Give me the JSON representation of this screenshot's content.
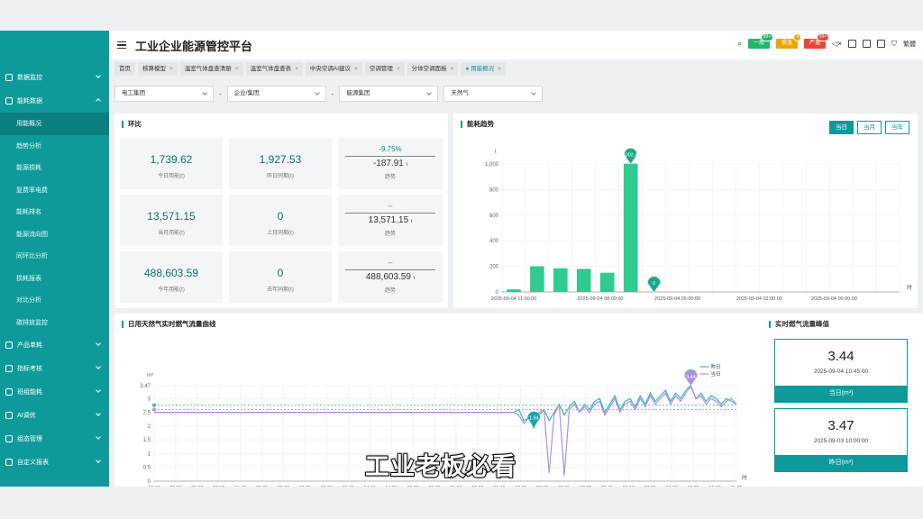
{
  "app": {
    "title": "工业企业能源管控平台",
    "subtitle_overlay": "工业老板必看"
  },
  "sidebar": {
    "items": [
      {
        "label": "数据监控",
        "expanded": false
      },
      {
        "label": "能耗数据",
        "expanded": true
      }
    ],
    "sub_items": [
      "用能概况",
      "趋势分析",
      "能源损耗",
      "复费率电费",
      "能耗排名",
      "能源流向图",
      "同环比分析",
      "损耗报表",
      "对比分析",
      "碳排放监控"
    ],
    "more_items": [
      "产品单耗",
      "指标考核",
      "班组能耗",
      "AI调优",
      "组态管理",
      "自定义报表"
    ]
  },
  "header": {
    "alarms": [
      {
        "label": "一般",
        "count": "99+",
        "color": "#1fb96a"
      },
      {
        "label": "紧急",
        "count": "4",
        "color": "#f0a500"
      },
      {
        "label": "严重",
        "count": "99+",
        "color": "#e8463c"
      }
    ],
    "lang": "繁體",
    "icons": [
      "search-icon",
      "mute-icon",
      "image-icon",
      "doc-icon",
      "copy-icon",
      "shirt-icon"
    ]
  },
  "tabs": [
    {
      "label": "首页",
      "closable": false
    },
    {
      "label": "核算模型",
      "closable": true
    },
    {
      "label": "温室气体盘查清册",
      "closable": true
    },
    {
      "label": "温室气体盘查表",
      "closable": true
    },
    {
      "label": "中央空调AI建议",
      "closable": true
    },
    {
      "label": "空调管理",
      "closable": true
    },
    {
      "label": "分体空调面板",
      "closable": true
    },
    {
      "label": "● 用能概况",
      "closable": true,
      "active": true
    }
  ],
  "filters": [
    "电工集团",
    "企业/集团",
    "能源集团",
    "天然气"
  ],
  "ring": {
    "title": "环比",
    "cards": [
      {
        "value": "1,739.62",
        "label": "今日用能(t)"
      },
      {
        "value": "1,927.53",
        "label": "昨日同期(t)"
      },
      {
        "pct": "-9.75%",
        "diff": "-187.91",
        "unit": "t",
        "label": "趋势"
      },
      {
        "value": "13,571.15",
        "label": "当月用能(t)"
      },
      {
        "value": "0",
        "label": "上月同期(t)"
      },
      {
        "pct": "--",
        "diff": "13,571.15",
        "unit": "t",
        "label": "趋势"
      },
      {
        "value": "488,603.59",
        "label": "今年用能(t)"
      },
      {
        "value": "0",
        "label": "去年同期(t)"
      },
      {
        "pct": "--",
        "diff": "488,603.59",
        "unit": "t",
        "label": "趋势"
      }
    ]
  },
  "trend": {
    "title": "能耗趋势",
    "buttons": [
      "当日",
      "当月",
      "当年"
    ],
    "active_button": "当日"
  },
  "flow": {
    "title": "日用天然气实时燃气流量曲线"
  },
  "peak": {
    "title": "实时燃气流量峰值",
    "cards": [
      {
        "value": "3.44",
        "time": "2025-09-04 10:45:00",
        "label": "当日(m³)"
      },
      {
        "value": "3.47",
        "time": "2025-09-03 10:00:00",
        "label": "昨日(m³)"
      }
    ]
  },
  "chart_data": [
    {
      "type": "bar",
      "title": "能耗趋势",
      "ylabel": "t",
      "xlabel": "时",
      "ylim": [
        0,
        1000
      ],
      "yticks": [
        0,
        200,
        400,
        600,
        800,
        1000
      ],
      "ytick_labels": [
        "0",
        "200",
        "400",
        "600",
        "800",
        "1,000"
      ],
      "xtick_labels": [
        "2025-09-04 11:00:00",
        "2025-09-04 08:00:00",
        "2025-09-04 05:00:00",
        "2025-09-04 02:00:00",
        "2025-09-04 00:00:00"
      ],
      "values": [
        20,
        200,
        185,
        180,
        150,
        1002.44,
        0,
        0,
        0,
        0,
        0,
        0,
        0,
        0,
        0,
        0,
        0
      ],
      "markers": [
        {
          "index": 5,
          "label": "1,002.44"
        },
        {
          "index": 6,
          "label": "0"
        }
      ],
      "color": "#2ecc8f"
    },
    {
      "type": "line",
      "title": "日用天然气实时燃气流量曲线",
      "ylabel": "m³",
      "xlabel": "时",
      "ylim": [
        0,
        3.47
      ],
      "yticks": [
        0,
        0.5,
        1,
        1.5,
        2,
        2.5,
        3,
        3.47
      ],
      "ytick_labels": [
        "0",
        "0.5",
        "1",
        "1.5",
        "2",
        "2.5",
        "3",
        "3.47"
      ],
      "x_labels": [
        "00:00",
        "00:25",
        "00:50",
        "01:15",
        "01:40",
        "02:05",
        "02:30",
        "02:55",
        "03:20",
        "03:45",
        "04:10",
        "04:35",
        "05:00",
        "05:25",
        "05:50",
        "06:15",
        "06:40",
        "07:05",
        "07:30",
        "07:55",
        "08:20",
        "08:45",
        "09:10",
        "09:35",
        "10:00",
        "10:25",
        "10:50",
        "11:05"
      ],
      "series": [
        {
          "name": "昨日",
          "color": "#3ab5c4",
          "average": 2.76,
          "max": 3.47,
          "min_label": "1.94",
          "values": [
            2.5,
            2.5,
            2.5,
            2.5,
            2.5,
            2.5,
            2.5,
            2.5,
            2.5,
            2.5,
            2.5,
            2.5,
            2.5,
            2.5,
            2.5,
            2.5,
            2.5,
            2.5,
            2.5,
            2.5,
            2.5,
            2.5,
            2.5,
            2.5,
            2.5,
            2.5,
            2.5,
            2.5,
            2.5,
            2.5,
            2.5,
            2.5,
            2.5,
            2.5,
            2.5,
            2.5,
            2.5,
            2.5,
            2.5,
            2.5,
            2.5,
            2.5,
            2.5,
            2.5,
            2.5,
            2.5,
            2.5,
            2.5,
            2.5,
            2.5,
            2.5,
            2.5,
            2.5,
            2.5,
            2.5,
            2.5,
            2.5,
            2.5,
            2.5,
            2.5,
            2.5,
            2.5,
            2.5,
            2.5,
            2.5,
            2.5,
            2.5,
            2.5,
            2.5,
            2.5,
            2.5,
            2.5,
            2.6,
            2.2,
            2.3,
            1.94,
            2.4,
            2.6,
            2.2,
            2.5,
            2.8,
            2.4,
            2.7,
            2.9,
            2.5,
            2.8,
            2.6,
            2.9,
            3.0,
            2.5,
            2.8,
            3.1,
            2.6,
            2.9,
            3.0,
            2.7,
            3.1,
            2.8,
            3.2,
            2.9,
            3.1,
            3.3,
            2.9,
            3.2,
            3.0,
            3.3,
            3.47,
            3.0,
            3.2,
            2.9,
            3.1,
            3.0,
            2.8,
            3.0,
            2.9,
            2.8
          ]
        },
        {
          "name": "当日",
          "color": "#b48ee0",
          "average": 2.6,
          "max": 3.44,
          "values": [
            2.5,
            2.5,
            2.5,
            2.5,
            2.5,
            2.5,
            2.5,
            2.5,
            2.5,
            2.5,
            2.5,
            2.5,
            2.5,
            2.5,
            2.5,
            2.5,
            2.5,
            2.5,
            2.5,
            2.5,
            2.5,
            2.5,
            2.5,
            2.5,
            2.5,
            2.5,
            2.5,
            2.5,
            2.5,
            2.5,
            2.5,
            2.5,
            2.5,
            2.5,
            2.5,
            2.5,
            2.5,
            2.5,
            2.5,
            2.5,
            2.5,
            2.5,
            2.5,
            2.5,
            2.5,
            2.5,
            2.5,
            2.5,
            2.5,
            2.5,
            2.5,
            2.5,
            2.5,
            2.5,
            2.5,
            2.5,
            2.5,
            2.5,
            2.5,
            2.5,
            2.5,
            2.5,
            2.5,
            2.5,
            2.5,
            2.5,
            2.5,
            2.5,
            2.5,
            2.5,
            2.5,
            2.5,
            2.4,
            2.1,
            2.3,
            2.2,
            2.5,
            2.6,
            0.3,
            2.4,
            2.8,
            0.2,
            2.6,
            2.8,
            2.5,
            2.7,
            2.5,
            2.8,
            2.9,
            2.4,
            2.7,
            3.0,
            2.5,
            2.8,
            2.9,
            2.6,
            3.0,
            2.7,
            3.1,
            2.8,
            3.0,
            3.2,
            2.8,
            3.1,
            2.9,
            3.2,
            3.44,
            3.0,
            3.1,
            2.8,
            3.0,
            2.9,
            2.7,
            2.9,
            3.0,
            2.8
          ]
        }
      ]
    }
  ]
}
